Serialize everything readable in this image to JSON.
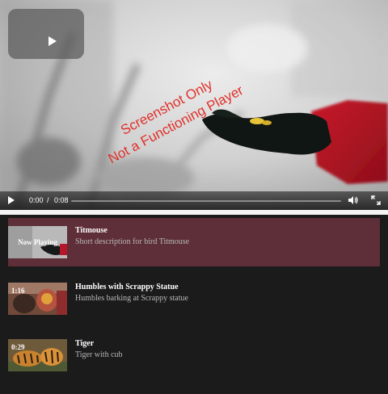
{
  "player": {
    "watermark_line1": "Screenshot Only",
    "watermark_line2": "Not a Functioning Player",
    "current_time": "0:00",
    "time_separator": "/",
    "duration": "0:08",
    "progress_fraction": 0,
    "icons": {
      "big_play": "play-icon",
      "play": "play-icon",
      "volume": "volume-icon",
      "fullscreen": "fullscreen-icon"
    }
  },
  "colors": {
    "active_item_bg": "#5e2f38",
    "watermark": "#e0302a",
    "page_bg": "#1b1b1b"
  },
  "playlist": {
    "items": [
      {
        "title": "Titmouse",
        "description": "Short description for bird Titmouse",
        "thumb_label": "Now Playing",
        "active": true
      },
      {
        "title": "Humbles with Scrappy Statue",
        "description": "Humbles barking at Scrappy statue",
        "thumb_label": "1:16",
        "active": false
      },
      {
        "title": "Tiger",
        "description": "Tiger with cub",
        "thumb_label": "0:29",
        "active": false
      }
    ]
  }
}
